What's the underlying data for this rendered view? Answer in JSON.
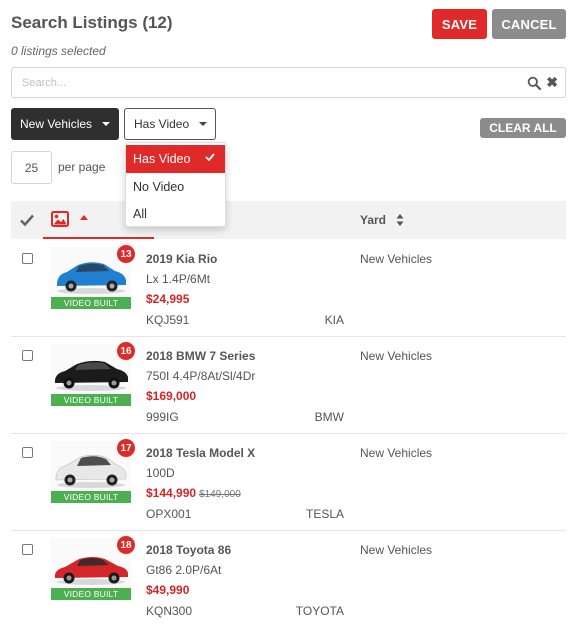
{
  "header": {
    "title": "Search Listings (12)",
    "subtitle": "0 listings selected",
    "save_label": "SAVE",
    "cancel_label": "CANCEL"
  },
  "search": {
    "placeholder": "Search...",
    "value": ""
  },
  "filters": {
    "yard_filter": "New Vehicles",
    "video_filter": "Has Video",
    "clear_label": "CLEAR ALL",
    "video_options": [
      "Has Video",
      "No Video",
      "All"
    ],
    "video_selected": "Has Video"
  },
  "paging": {
    "per_page": "25",
    "per_page_label": "per page"
  },
  "table": {
    "col_yard": "Yard",
    "rows": [
      {
        "badge": "13",
        "video_label": "VIDEO BUILT",
        "name": "2019 Kia Rio",
        "trim": "Lx 1.4P/6Mt",
        "price": "$24,995",
        "old_price": "",
        "stock": "KQJ591",
        "make": "KIA",
        "yard": "New Vehicles",
        "car_color": "#1f7fd0"
      },
      {
        "badge": "16",
        "video_label": "VIDEO BUILT",
        "name": "2018 BMW 7 Series",
        "trim": "750I 4.4P/8At/Sl/4Dr",
        "price": "$169,000",
        "old_price": "",
        "stock": "999IG",
        "make": "BMW",
        "yard": "New Vehicles",
        "car_color": "#1b1b1b"
      },
      {
        "badge": "17",
        "video_label": "VIDEO BUILT",
        "name": "2018 Tesla Model X",
        "trim": "100D",
        "price": "$144,990",
        "old_price": "$149,000",
        "stock": "OPX001",
        "make": "TESLA",
        "yard": "New Vehicles",
        "car_color": "#e8e8e8"
      },
      {
        "badge": "18",
        "video_label": "VIDEO BUILT",
        "name": "2018 Toyota 86",
        "trim": "Gt86 2.0P/6At",
        "price": "$49,990",
        "old_price": "",
        "stock": "KQN300",
        "make": "TOYOTA",
        "yard": "New Vehicles",
        "car_color": "#d3262a"
      }
    ]
  },
  "colors": {
    "accent": "#e02a2a",
    "muted_button": "#8c8c8c",
    "video_badge": "#4caf50"
  }
}
